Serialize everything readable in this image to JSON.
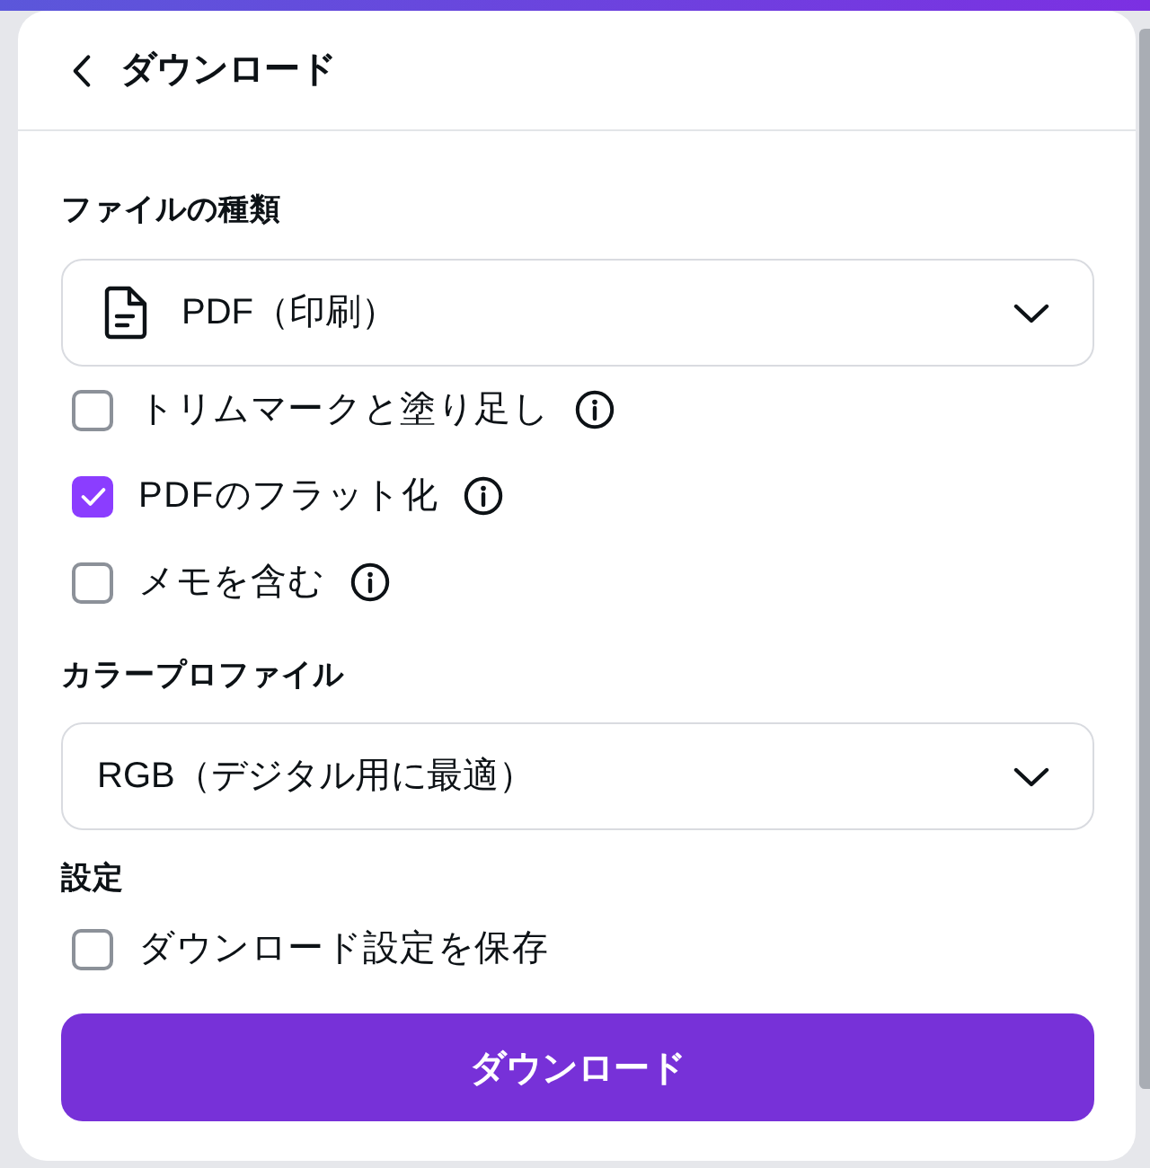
{
  "header": {
    "title": "ダウンロード"
  },
  "file_type": {
    "label": "ファイルの種類",
    "value": "PDF（印刷）"
  },
  "options": [
    {
      "label": "トリムマークと塗り足し",
      "checked": false,
      "info": true
    },
    {
      "label": "PDFのフラット化",
      "checked": true,
      "info": true
    },
    {
      "label": "メモを含む",
      "checked": false,
      "info": true
    }
  ],
  "color_profile": {
    "label": "カラープロファイル",
    "value": "RGB（デジタル用に最適）"
  },
  "settings": {
    "label": "設定",
    "options": [
      {
        "label": "ダウンロード設定を保存",
        "checked": false,
        "info": false
      }
    ]
  },
  "download_button": {
    "label": "ダウンロード"
  }
}
